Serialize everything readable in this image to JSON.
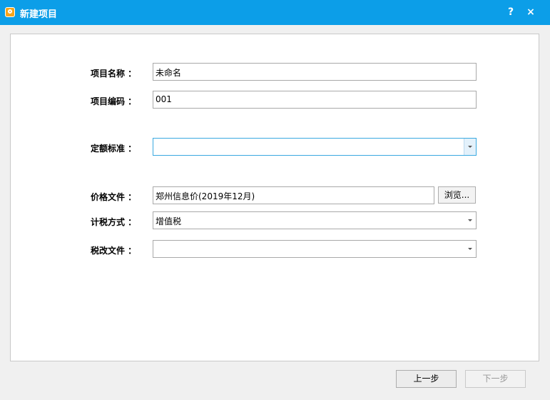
{
  "window": {
    "title": "新建项目",
    "help_label": "?",
    "close_label": "×",
    "app_icon": "app-logo-icon"
  },
  "form": {
    "project_name": {
      "label": "项目名称 ：",
      "value": "未命名"
    },
    "project_code": {
      "label": "项目编码 ：",
      "value": "001"
    },
    "quota_standard": {
      "label": "定额标准 ：",
      "value": ""
    },
    "price_file": {
      "label": "价格文件 ：",
      "value": "郑州信息价(2019年12月)",
      "browse_label": "浏览..."
    },
    "tax_method": {
      "label": "计税方式 ：",
      "value": "增值税"
    },
    "tax_reform_file": {
      "label": "税改文件 ：",
      "value": ""
    }
  },
  "footer": {
    "prev_label": "上一步",
    "next_label": "下一步",
    "next_enabled": false
  },
  "colors": {
    "titlebar": "#0c9ee8",
    "focus_border": "#3aa9e0"
  }
}
